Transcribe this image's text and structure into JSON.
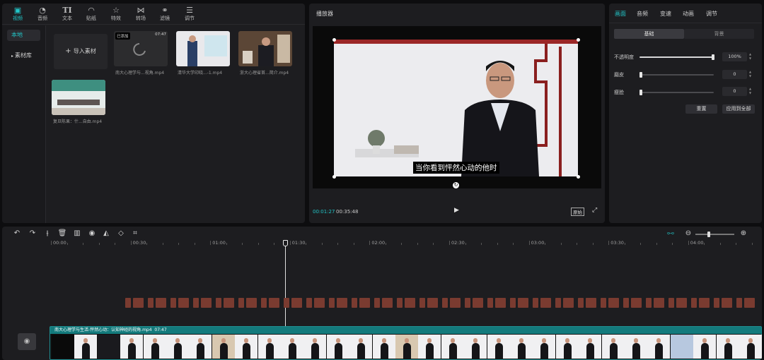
{
  "toolbar": {
    "items": [
      {
        "label": "视频",
        "icon": "video-icon",
        "glyph": "▣"
      },
      {
        "label": "音频",
        "icon": "audio-icon",
        "glyph": "◔"
      },
      {
        "label": "文本",
        "icon": "text-icon",
        "glyph": "TI"
      },
      {
        "label": "贴纸",
        "icon": "sticker-icon",
        "glyph": "◠"
      },
      {
        "label": "特效",
        "icon": "effects-icon",
        "glyph": "☆"
      },
      {
        "label": "转场",
        "icon": "transition-icon",
        "glyph": "⋈"
      },
      {
        "label": "滤镜",
        "icon": "filter-icon",
        "glyph": "⚭"
      },
      {
        "label": "调节",
        "icon": "adjust-icon",
        "glyph": "☰"
      }
    ]
  },
  "sidebar": {
    "local": "本地",
    "library": "素材库"
  },
  "media": {
    "import_label": "导入素材",
    "items": [
      {
        "caption": "南大心理学与...视角.mp4",
        "badge": "已添加",
        "duration": "07:47"
      },
      {
        "caption": "清华大学印晓...-1.mp4"
      },
      {
        "caption": "浙大心理省首...简介.mp4"
      },
      {
        "caption": "复旦陈果：什...自由.mp4"
      }
    ]
  },
  "player": {
    "title": "播放器",
    "subtitle": "当你看到怦然心动的他时",
    "current_time": "00:01:27",
    "total_time": "00:35:48",
    "ratio_label": "原始"
  },
  "properties": {
    "tabs": [
      "画面",
      "音频",
      "变速",
      "动画",
      "调节"
    ],
    "segments": [
      "基础",
      "背景"
    ],
    "opacity": {
      "label": "不透明度",
      "value": "100%",
      "level": 1.0
    },
    "saturation": {
      "label": "磨皮",
      "value": "0",
      "level": 0
    },
    "thin_face": {
      "label": "瘦脸",
      "value": "0",
      "level": 0
    },
    "reset_label": "重置",
    "apply_all_label": "应用到全部"
  },
  "timeline": {
    "ruler": [
      "00:00",
      "00:30",
      "01:00",
      "01:30",
      "02:00",
      "02:30",
      "03:00",
      "03:30",
      "04:00"
    ],
    "main_clip_label": "南大心理学与生活-怦然心动：认知神经的视角.mp4",
    "main_clip_duration": "07:47"
  },
  "colors": {
    "accent": "#22c5c7",
    "clip": "#137a7c",
    "subtitle_clip": "#7a3b30"
  }
}
